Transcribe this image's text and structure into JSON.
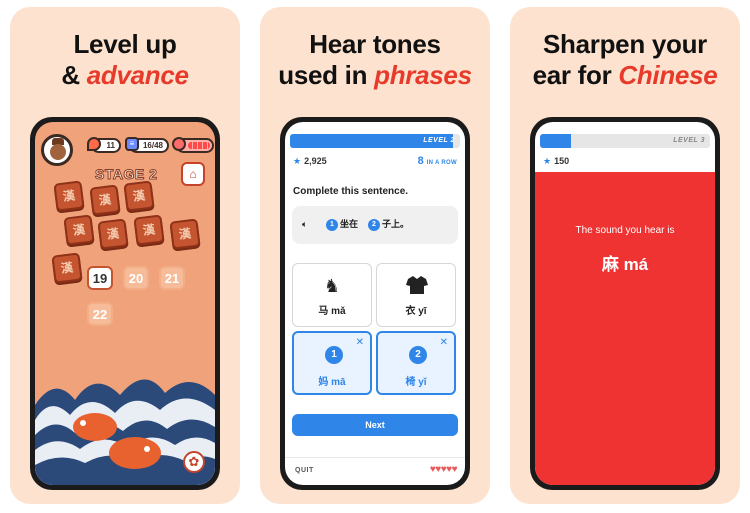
{
  "cards": [
    {
      "headline_line1": "Level up",
      "headline_prefix": "& ",
      "headline_accent": "advance",
      "hud": {
        "streak": "11",
        "progress": "16/48",
        "streak_icon": "flame-icon",
        "progress_icon": "lesson-icon",
        "hearts_icon": "heart-icon"
      },
      "stage_title": "STAGE 2",
      "tile_glyph": "漢",
      "levels": {
        "current": "19",
        "next1": "20",
        "next2": "21",
        "next3": "22"
      }
    },
    {
      "headline_line1": "Hear tones",
      "headline_prefix": "used in ",
      "headline_accent": "phrases",
      "progress_label": "LEVEL 2",
      "progress_fraction": 0.96,
      "score": "2,925",
      "streak_count": "8",
      "streak_label": "IN A ROW",
      "prompt": "Complete this sentence.",
      "sentence": {
        "blank1": "1",
        "word1": "坐在",
        "blank2": "2",
        "word2": "子上。"
      },
      "options": [
        {
          "label": "马 mǎ",
          "icon": "horse-icon"
        },
        {
          "label": "衣 yī",
          "icon": "shirt-icon"
        },
        {
          "number": "1",
          "label": "妈 mā"
        },
        {
          "number": "2",
          "label": "椅 yǐ"
        }
      ],
      "next_label": "Next",
      "quit_label": "QUIT",
      "hearts_count": 5
    },
    {
      "headline_line1": "Sharpen your",
      "headline_prefix": "ear for ",
      "headline_accent": "Chinese",
      "progress_label": "LEVEL 3",
      "progress_fraction": 0.18,
      "score": "150",
      "sound_line": "The sound you hear is",
      "answer": "麻 má"
    }
  ],
  "colors": {
    "card_bg": "#fde3cf",
    "accent": "#e83a2a",
    "blue": "#2f86e8",
    "red_panel": "#ef3232"
  }
}
